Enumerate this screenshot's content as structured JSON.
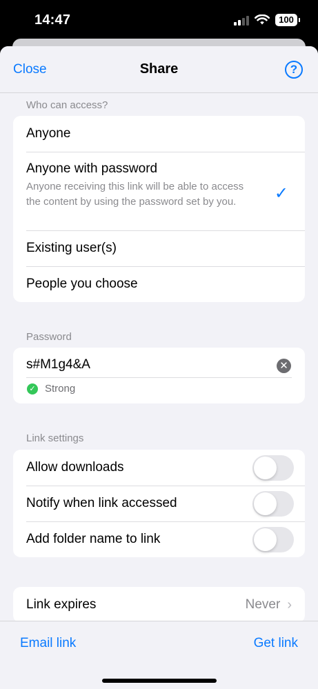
{
  "status": {
    "time": "14:47",
    "battery": "100"
  },
  "nav": {
    "close": "Close",
    "title": "Share",
    "help": "?"
  },
  "access": {
    "header": "Who can access?",
    "options": [
      {
        "label": "Anyone"
      },
      {
        "label": "Anyone with password",
        "description": "Anyone receiving this link will be able to access the content by using the password set by you.",
        "selected": true
      },
      {
        "label": "Existing user(s)"
      },
      {
        "label": "People you choose"
      }
    ],
    "check_glyph": "✓"
  },
  "password": {
    "header": "Password",
    "value": "s#M1g4&A",
    "strength": "Strong",
    "clear_glyph": "✕",
    "strength_glyph": "✓"
  },
  "link_settings": {
    "header": "Link settings",
    "toggles": [
      {
        "label": "Allow downloads",
        "on": false
      },
      {
        "label": "Notify when link accessed",
        "on": false
      },
      {
        "label": "Add folder name to link",
        "on": false
      }
    ]
  },
  "expiry": {
    "label": "Link expires",
    "value": "Never",
    "chevron": "›"
  },
  "bottom": {
    "email": "Email link",
    "get": "Get link"
  },
  "colors": {
    "accent": "#0a7aff",
    "success": "#34c759",
    "background": "#f2f2f7"
  },
  "icons": [
    "wifi-icon",
    "signal-icon",
    "battery-icon",
    "help-icon",
    "checkmark-icon",
    "clear-icon",
    "chevron-right-icon"
  ]
}
